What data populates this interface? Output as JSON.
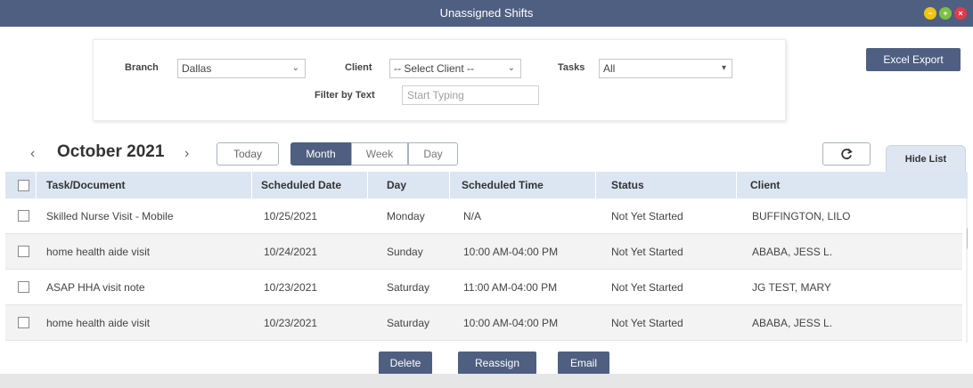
{
  "window": {
    "title": "Unassigned Shifts"
  },
  "filters": {
    "branch_label": "Branch",
    "branch_value": "Dallas",
    "client_label": "Client",
    "client_value": "-- Select Client --",
    "tasks_label": "Tasks",
    "tasks_value": "All",
    "filter_text_label": "Filter by Text",
    "filter_text_placeholder": "Start Typing"
  },
  "toolbar": {
    "excel_export": "Excel Export"
  },
  "calendar": {
    "month_label": "October 2021",
    "prev_icon": "‹",
    "next_icon": "›",
    "today": "Today",
    "views": [
      "Month",
      "Week",
      "Day"
    ],
    "active_view": "Month",
    "hide_list": "Hide List"
  },
  "table": {
    "columns": [
      "Task/Document",
      "Scheduled Date",
      "Day",
      "Scheduled Time",
      "Status",
      "Client"
    ],
    "rows": [
      [
        "Skilled Nurse Visit - Mobile",
        "10/25/2021",
        "Monday",
        "N/A",
        "Not Yet Started",
        "BUFFINGTON, LILO"
      ],
      [
        "home health aide visit",
        "10/24/2021",
        "Sunday",
        "10:00 AM-04:00 PM",
        "Not Yet Started",
        "ABABA, JESS L."
      ],
      [
        "ASAP HHA visit note",
        "10/23/2021",
        "Saturday",
        "11:00 AM-04:00 PM",
        "Not Yet Started",
        "JG TEST, MARY"
      ],
      [
        "home health aide visit",
        "10/23/2021",
        "Saturday",
        "10:00 AM-04:00 PM",
        "Not Yet Started",
        "ABABA, JESS L."
      ]
    ]
  },
  "actions": {
    "delete": "Delete",
    "reassign": "Reassign",
    "email": "Email"
  },
  "colors": {
    "accent": "#4e5f81",
    "header_bg": "#dce6f2",
    "min": "#f1c40f",
    "max": "#7bc142",
    "close": "#e23b4b"
  }
}
